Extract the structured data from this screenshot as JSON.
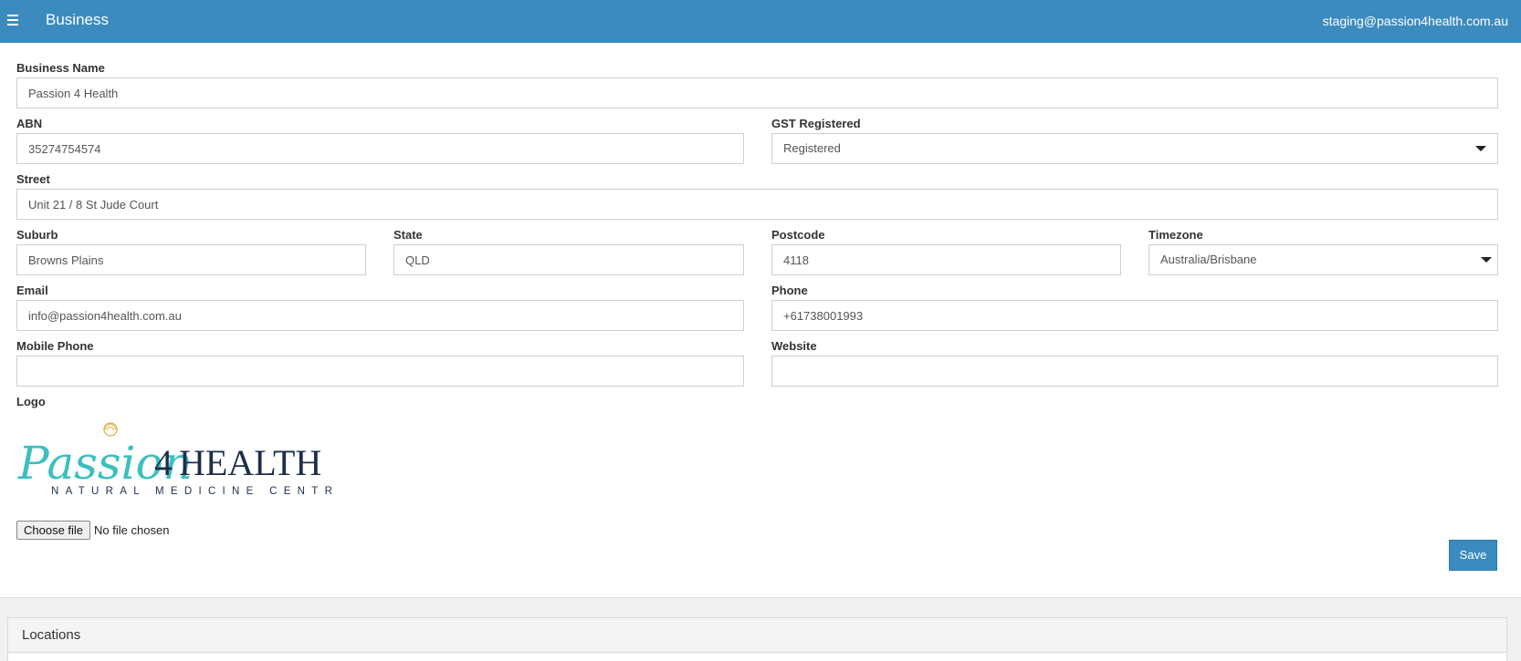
{
  "header": {
    "title": "Business",
    "user_email": "staging@passion4health.com.au",
    "menu_icon": "hamburger-icon"
  },
  "form": {
    "business_name": {
      "label": "Business Name",
      "value": "Passion 4 Health"
    },
    "abn": {
      "label": "ABN",
      "value": "35274754574"
    },
    "gst_registered": {
      "label": "GST Registered",
      "value": "Registered"
    },
    "street": {
      "label": "Street",
      "value": "Unit 21 / 8 St Jude Court"
    },
    "suburb": {
      "label": "Suburb",
      "value": "Browns Plains"
    },
    "state": {
      "label": "State",
      "value": "QLD"
    },
    "postcode": {
      "label": "Postcode",
      "value": "4118"
    },
    "timezone": {
      "label": "Timezone",
      "value": "Australia/Brisbane"
    },
    "email": {
      "label": "Email",
      "value": "info@passion4health.com.au"
    },
    "phone": {
      "label": "Phone",
      "value": "+61738001993"
    },
    "mobile_phone": {
      "label": "Mobile Phone",
      "value": ""
    },
    "website": {
      "label": "Website",
      "value": ""
    },
    "logo": {
      "label": "Logo",
      "brand_script": "Passion",
      "brand_number": "4",
      "brand_word": "HEALTH",
      "tagline": "NATURAL MEDICINE CENTRE",
      "colors": {
        "teal": "#3bbfbf",
        "navy": "#1c2e4a",
        "gold": "#d9b24a"
      }
    },
    "file": {
      "button_label": "Choose file",
      "status": "No file chosen"
    },
    "save_label": "Save"
  },
  "locations": {
    "title": "Locations"
  },
  "colors": {
    "accent": "#3b8bbf"
  }
}
